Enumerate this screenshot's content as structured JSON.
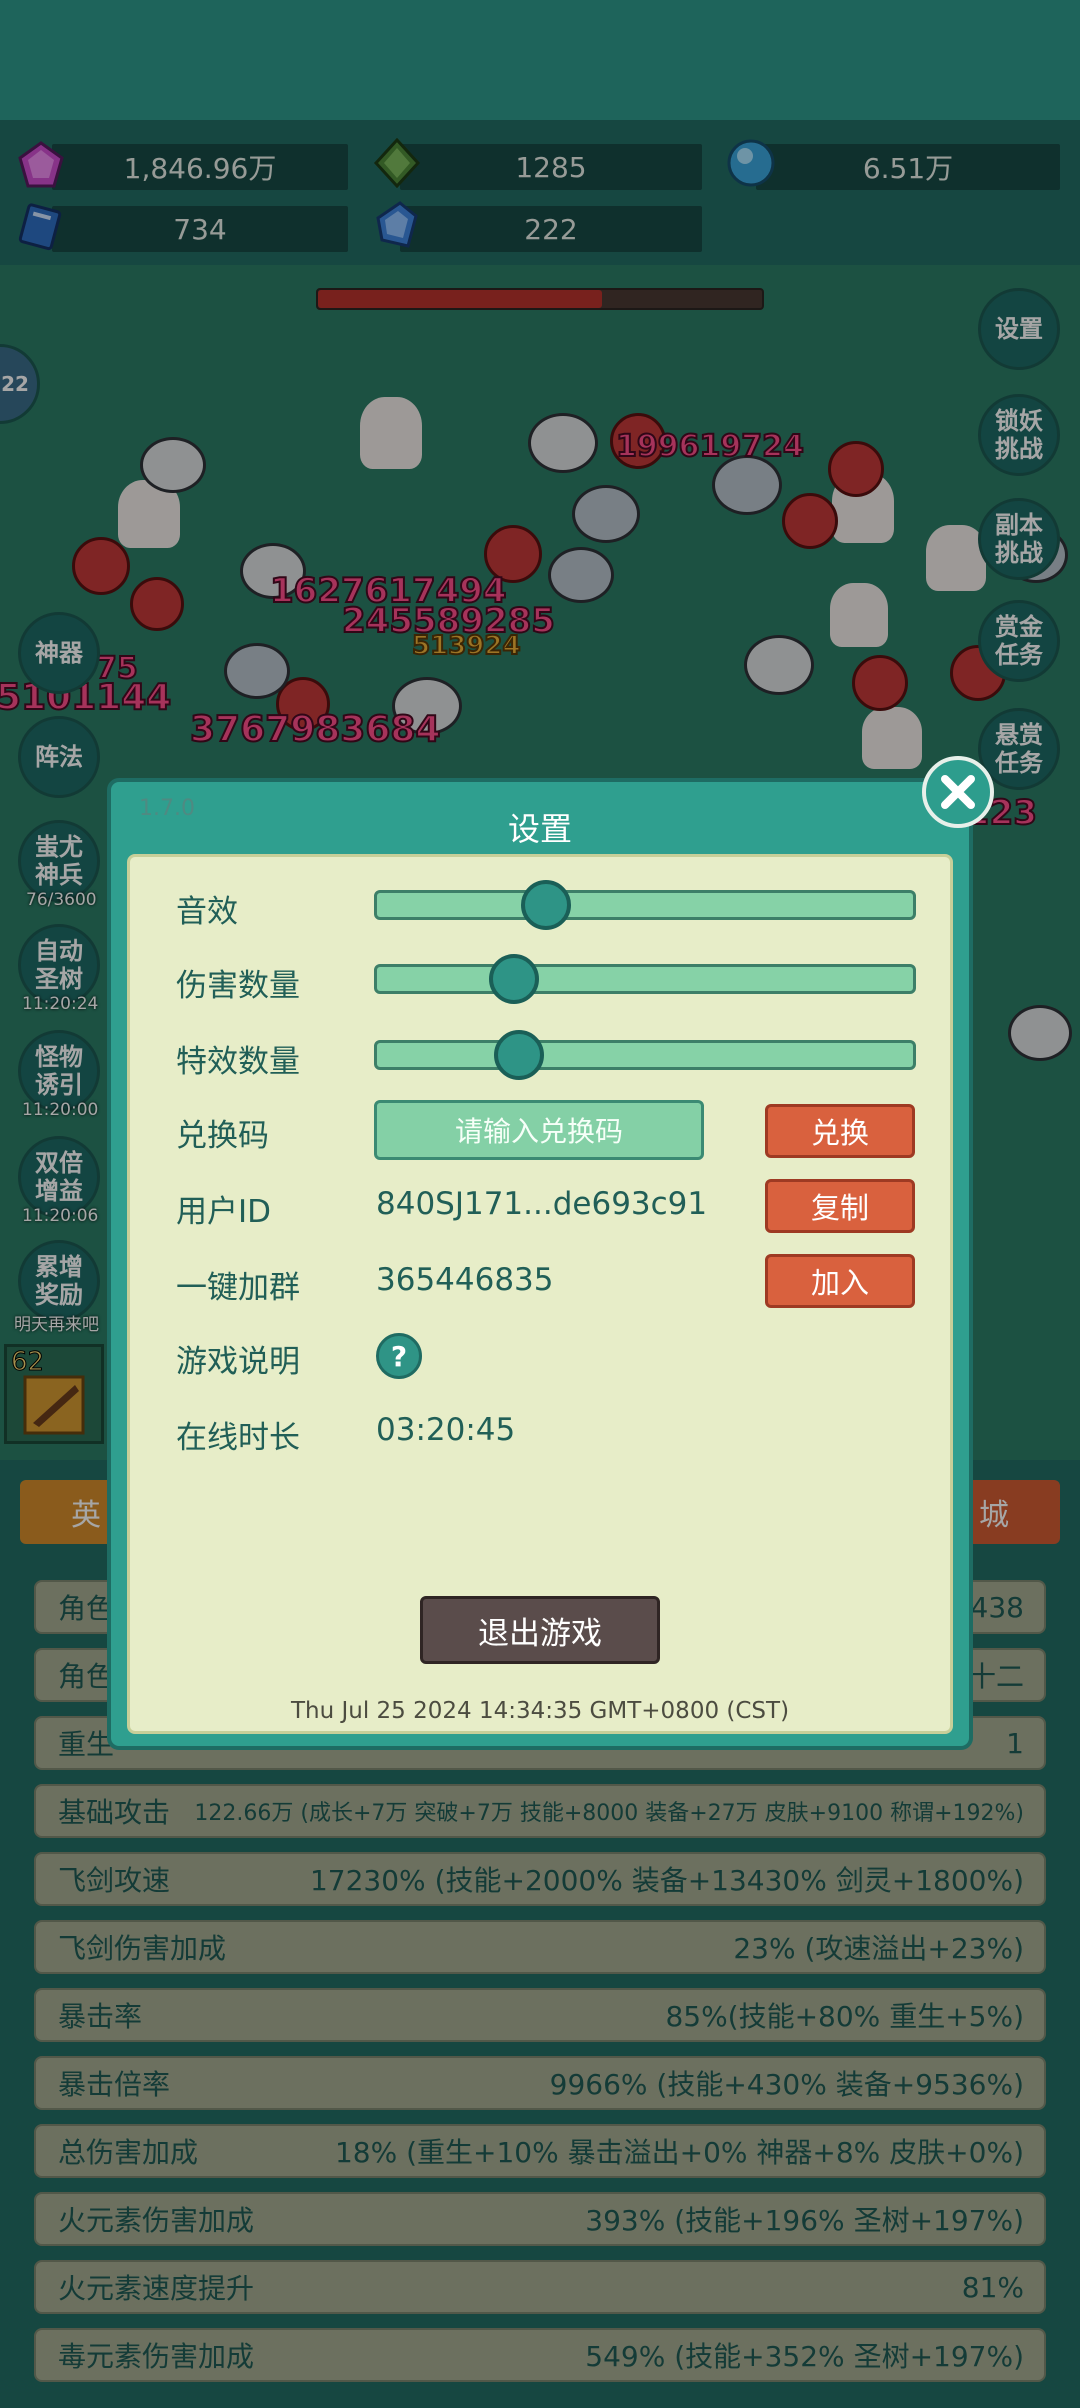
{
  "resources": {
    "gem": "1,846.96万",
    "crystal": "1285",
    "orb": "6.51万",
    "book": "734",
    "shard": "222"
  },
  "sidebar_right": [
    {
      "label": "设置"
    },
    {
      "label": "锁妖\n挑战"
    },
    {
      "label": "副本\n挑战"
    },
    {
      "label": "赏金\n任务"
    },
    {
      "label": "悬赏\n任务"
    }
  ],
  "sidebar_left": {
    "shenqi": "神器",
    "zhenfa": "阵法",
    "chiyou": "蚩尤\n神兵",
    "chiyou_count": "76/3600",
    "zidong": "自动\n圣树",
    "zidong_time": "11:20:24",
    "guaiwu": "怪物\n诱引",
    "guaiwu_time": "11:20:00",
    "shuangbei": "双倍\n增益",
    "shuangbei_time": "11:20:06",
    "leizeng": "累增\n奖励",
    "leizeng_note": "明天再来吧",
    "level": "62",
    "level_small": "22"
  },
  "damage_numbers": [
    "199619724",
    "1627617494",
    "245589285",
    "513924",
    "3767983684",
    "5101144",
    "75",
    "223"
  ],
  "tabs": {
    "left": "英",
    "right": "城"
  },
  "stats": [
    {
      "label": "角色",
      "value": "438"
    },
    {
      "label": "角色",
      "value": "十二"
    },
    {
      "label": "重生",
      "value": "1"
    },
    {
      "label": "基础攻击",
      "value": "122.66万 (成长+7万 突破+7万 技能+8000 装备+27万 皮肤+9100 称谓+192%)"
    },
    {
      "label": "飞剑攻速",
      "value": "17230% (技能+2000% 装备+13430% 剑灵+1800%)"
    },
    {
      "label": "飞剑伤害加成",
      "value": "23% (攻速溢出+23%)"
    },
    {
      "label": "暴击率",
      "value": "85%(技能+80% 重生+5%)"
    },
    {
      "label": "暴击倍率",
      "value": "9966% (技能+430% 装备+9536%)"
    },
    {
      "label": "总伤害加成",
      "value": "18% (重生+10% 暴击溢出+0% 神器+8% 皮肤+0%)"
    },
    {
      "label": "火元素伤害加成",
      "value": "393% (技能+196% 圣树+197%)"
    },
    {
      "label": "火元素速度提升",
      "value": "81%"
    },
    {
      "label": "毒元素伤害加成",
      "value": "549% (技能+352% 圣树+197%)"
    }
  ],
  "settings": {
    "version": "1.7.0",
    "title": "设置",
    "sound_label": "音效",
    "sound_level": 0.3,
    "damage_count_label": "伤害数量",
    "damage_count_level": 0.24,
    "effects_count_label": "特效数量",
    "effects_count_level": 0.25,
    "redeem_label": "兑换码",
    "redeem_placeholder": "请输入兑换码",
    "redeem_button": "兑换",
    "user_id_label": "用户ID",
    "user_id_value": "840SJ171...de693c91",
    "copy_button": "复制",
    "group_label": "一键加群",
    "group_value": "365446835",
    "join_button": "加入",
    "help_label": "游戏说明",
    "help_glyph": "?",
    "online_label": "在线时长",
    "online_value": "03:20:45",
    "exit_button": "退出游戏",
    "timestamp": "Thu Jul 25 2024 14:34:35 GMT+0800 (CST)"
  }
}
